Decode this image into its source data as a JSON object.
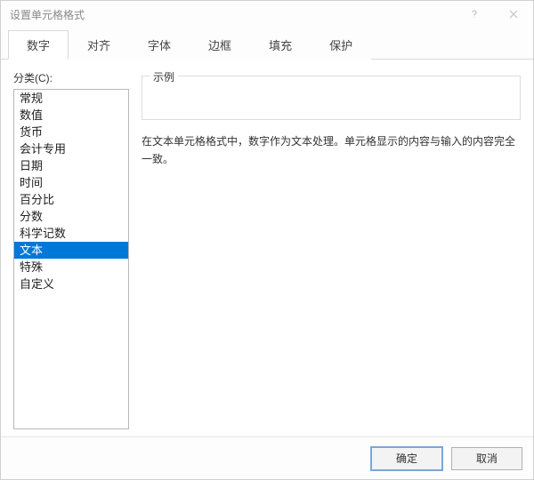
{
  "window": {
    "title": "设置单元格格式"
  },
  "tabs": [
    {
      "label": "数字",
      "active": true
    },
    {
      "label": "对齐",
      "active": false
    },
    {
      "label": "字体",
      "active": false
    },
    {
      "label": "边框",
      "active": false
    },
    {
      "label": "填充",
      "active": false
    },
    {
      "label": "保护",
      "active": false
    }
  ],
  "category": {
    "label": "分类(C):",
    "items": [
      "常规",
      "数值",
      "货币",
      "会计专用",
      "日期",
      "时间",
      "百分比",
      "分数",
      "科学记数",
      "文本",
      "特殊",
      "自定义"
    ],
    "selected_index": 9
  },
  "sample": {
    "legend": "示例",
    "value": ""
  },
  "description": "在文本单元格格式中，数字作为文本处理。单元格显示的内容与输入的内容完全一致。",
  "buttons": {
    "ok": "确定",
    "cancel": "取消"
  }
}
